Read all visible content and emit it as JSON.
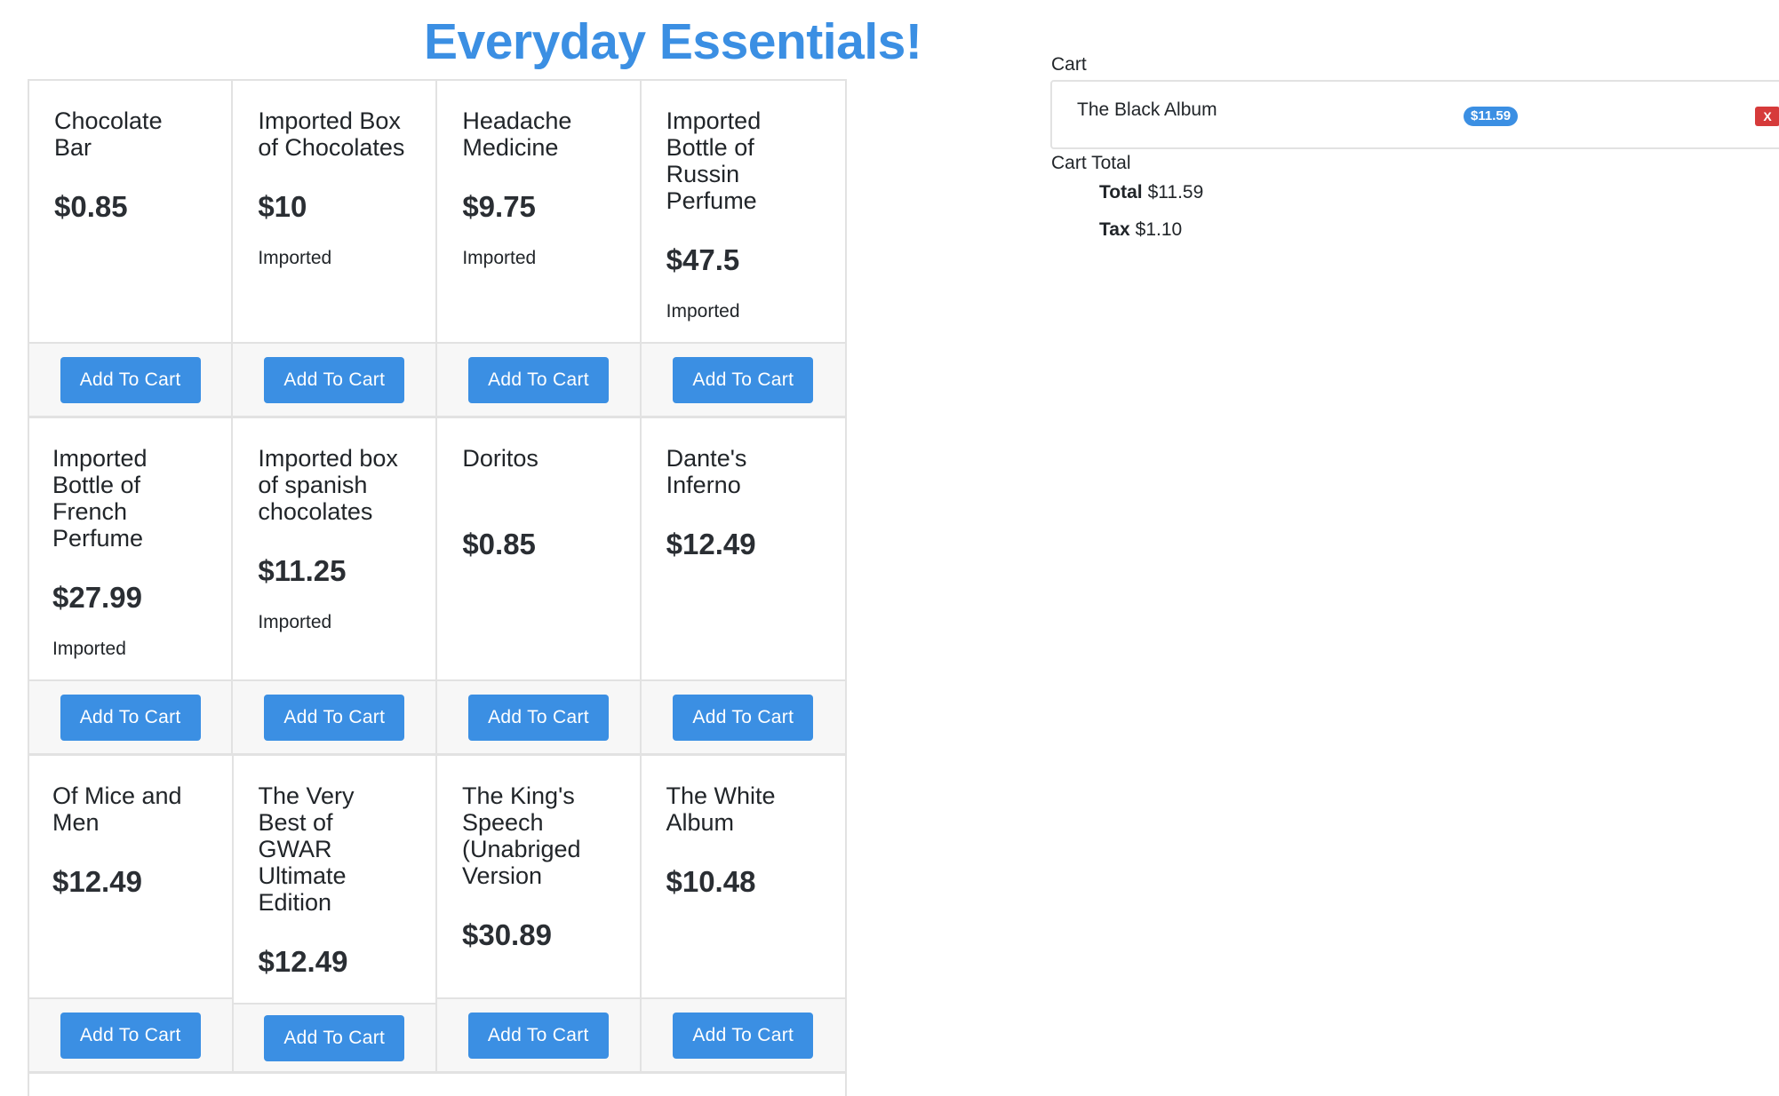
{
  "header": {
    "title": "Everyday Essentials!"
  },
  "products": [
    {
      "name": "Chocolate Bar",
      "price": "$0.85",
      "tag": ""
    },
    {
      "name": "Imported Box of Chocolates",
      "price": "$10",
      "tag": "Imported"
    },
    {
      "name": "Headache Medicine",
      "price": "$9.75",
      "tag": "Imported"
    },
    {
      "name": "Imported Bottle of Russin Perfume",
      "price": "$47.5",
      "tag": "Imported"
    },
    {
      "name": "Imported Bottle of French Perfume",
      "price": "$27.99",
      "tag": "Imported"
    },
    {
      "name": "Imported box of spanish chocolates",
      "price": "$11.25",
      "tag": "Imported"
    },
    {
      "name": "Doritos",
      "price": "$0.85",
      "tag": ""
    },
    {
      "name": "Dante's Inferno",
      "price": "$12.49",
      "tag": ""
    },
    {
      "name": "Of Mice and Men",
      "price": "$12.49",
      "tag": ""
    },
    {
      "name": "The Very Best of GWAR Ultimate Edition",
      "price": "$12.49",
      "tag": ""
    },
    {
      "name": "The King's Speech (Unabriged Version",
      "price": "$30.89",
      "tag": ""
    },
    {
      "name": "The White Album",
      "price": "$10.48",
      "tag": ""
    }
  ],
  "add_button_label": "Add To Cart",
  "cart": {
    "label": "Cart",
    "items": [
      {
        "name": "The Black Album",
        "price": "$11.59",
        "remove_label": "X"
      }
    ],
    "total_label": "Cart Total",
    "total_key": "Total",
    "total_value": "$11.59",
    "tax_key": "Tax",
    "tax_value": "$1.10"
  },
  "colors": {
    "accent": "#3b8fe3",
    "danger": "#d63a3a",
    "border": "#e2e2e2"
  }
}
